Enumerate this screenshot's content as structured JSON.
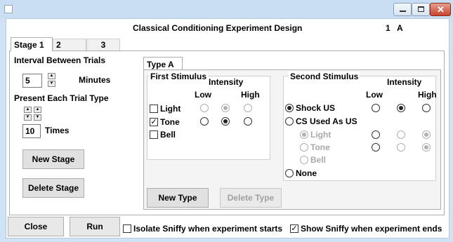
{
  "window": {
    "title": ""
  },
  "header": {
    "title": "Classical Conditioning Experiment Design",
    "stage_num": "1",
    "type_letter": "A"
  },
  "stage_tabs": [
    "Stage 1",
    "2",
    "3"
  ],
  "left": {
    "interval_label": "Interval Between Trials",
    "interval_value": "5",
    "minutes_label": "Minutes",
    "present_label": "Present Each Trial Type",
    "times_value": "10",
    "times_label": "Times",
    "new_stage": "New Stage",
    "delete_stage": "Delete Stage"
  },
  "type_tab": "Type A",
  "first": {
    "title": "First Stimulus",
    "intensity": "Intensity",
    "low": "Low",
    "high": "High",
    "items": [
      {
        "label": "Light",
        "checked": false
      },
      {
        "label": "Tone",
        "checked": true
      },
      {
        "label": "Bell",
        "checked": false
      }
    ]
  },
  "second": {
    "title": "Second Stimulus",
    "intensity": "Intensity",
    "low": "Low",
    "high": "High",
    "shock": "Shock US",
    "cs_used": "CS Used As US",
    "light": "Light",
    "tone": "Tone",
    "bell": "Bell",
    "none": "None"
  },
  "type_buttons": {
    "new_type": "New Type",
    "delete_type": "Delete Type"
  },
  "bottom": {
    "close": "Close",
    "run": "Run",
    "isolate": "Isolate Sniffy when experiment starts",
    "isolate_checked": false,
    "show": "Show Sniffy when experiment ends",
    "show_checked": true
  }
}
